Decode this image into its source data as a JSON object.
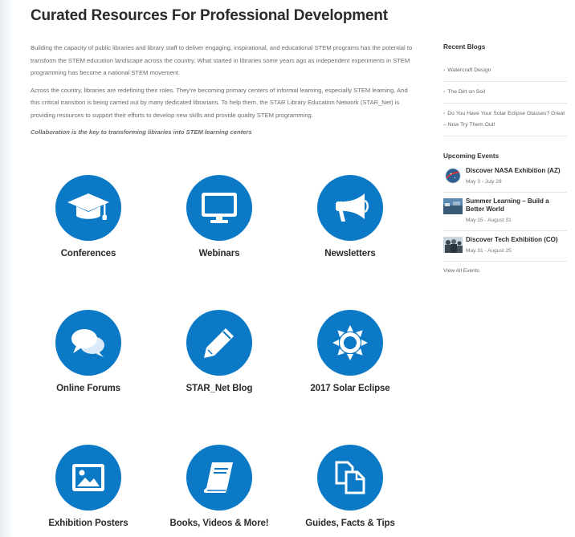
{
  "page": {
    "title": "Curated Resources For Professional Development",
    "intro_p1": "Building the capacity of public libraries and library staff to deliver engaging, inspirational, and educational STEM programs has the potential to transform the STEM education landscape across the country. What started in libraries some years ago as independent experiments in STEM programming has become a national STEM movement.",
    "intro_p2": "Across the country, libraries are redefining their roles. They're becoming primary centers of informal learning, especially STEM learning. And this critical transition is being carried out by many dedicated librarians. To help them, the STAR Library Education Network (STAR_Net) is providing resources to support their efforts to develop new skills and provide quality STEM programming.",
    "tagline": "Collaboration is the key to transforming libraries into STEM learning centers"
  },
  "resources": [
    {
      "label": "Conferences",
      "icon": "graduation-cap-icon"
    },
    {
      "label": "Webinars",
      "icon": "monitor-icon"
    },
    {
      "label": "Newsletters",
      "icon": "megaphone-icon"
    },
    {
      "label": "Online Forums",
      "icon": "chat-bubbles-icon"
    },
    {
      "label": "STAR_Net Blog",
      "icon": "pencil-icon"
    },
    {
      "label": "2017 Solar Eclipse",
      "icon": "sun-icon"
    },
    {
      "label": "Exhibition Posters",
      "icon": "picture-icon"
    },
    {
      "label": "Books, Videos & More!",
      "icon": "book-icon"
    },
    {
      "label": "Guides, Facts & Tips",
      "icon": "copy-documents-icon"
    }
  ],
  "sidebar": {
    "recent_blogs_heading": "Recent Blogs",
    "blogs": [
      {
        "label": "Watercraft Design"
      },
      {
        "label": "The Dirt on Soil"
      },
      {
        "label": "Do You Have Your Solar Eclipse Glasses? Great – Now Try Them Out!"
      }
    ],
    "events_heading": "Upcoming Events",
    "events": [
      {
        "title": "Discover NASA Exhibition (AZ)",
        "date": "May 3 - July 28",
        "thumb": "nasa-logo-icon"
      },
      {
        "title": "Summer Learning – Build a Better World",
        "date": "May 15 - August 31",
        "thumb": "landscape-thumbnail"
      },
      {
        "title": "Discover Tech Exhibition (CO)",
        "date": "May 31 - August 25",
        "thumb": "people-thumbnail"
      }
    ],
    "view_all": "View All Events"
  },
  "colors": {
    "accent_blue": "#0b79c6",
    "title_text": "#2b2b2b",
    "body_text": "#6b6b6b"
  }
}
